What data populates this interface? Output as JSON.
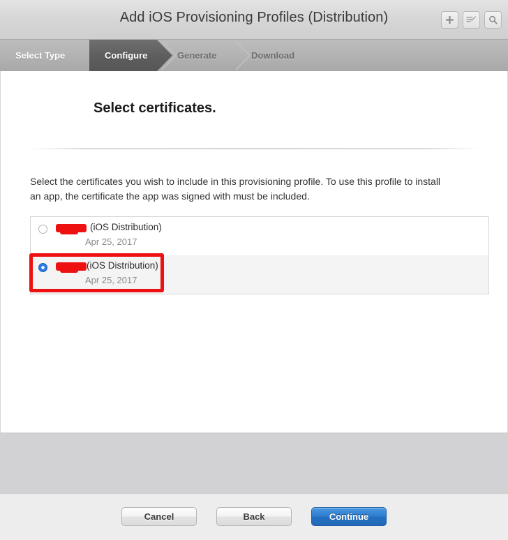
{
  "window": {
    "title": "Add iOS Provisioning Profiles (Distribution)"
  },
  "titlebar_actions": [
    {
      "name": "add-icon",
      "label": "+"
    },
    {
      "name": "edit-icon",
      "label": "Edit"
    },
    {
      "name": "search-icon",
      "label": "Search"
    }
  ],
  "steps": [
    {
      "label": "Select Type",
      "state": "done"
    },
    {
      "label": "Configure",
      "state": "active"
    },
    {
      "label": "Generate",
      "state": "upcoming"
    },
    {
      "label": "Download",
      "state": "upcoming"
    }
  ],
  "main": {
    "heading": "Select certificates.",
    "intro": "Select the certificates you wish to include in this provisioning profile. To use this profile to install an app, the certificate the app was signed with must be included."
  },
  "certificates": [
    {
      "name_redacted": "",
      "type": "(iOS Distribution)",
      "date": "Apr 25, 2017",
      "selected": false,
      "annotated": false
    },
    {
      "name_redacted": "",
      "type": "(iOS Distribution)",
      "date": "Apr 25, 2017",
      "selected": true,
      "annotated": true
    }
  ],
  "footer": {
    "cancel_label": "Cancel",
    "back_label": "Back",
    "continue_label": "Continue"
  },
  "colors": {
    "accent_blue": "#2c7be5",
    "annotation_red": "#ee1111",
    "active_step": "#5d5d5d",
    "titlebar": "#d6d6d6"
  }
}
